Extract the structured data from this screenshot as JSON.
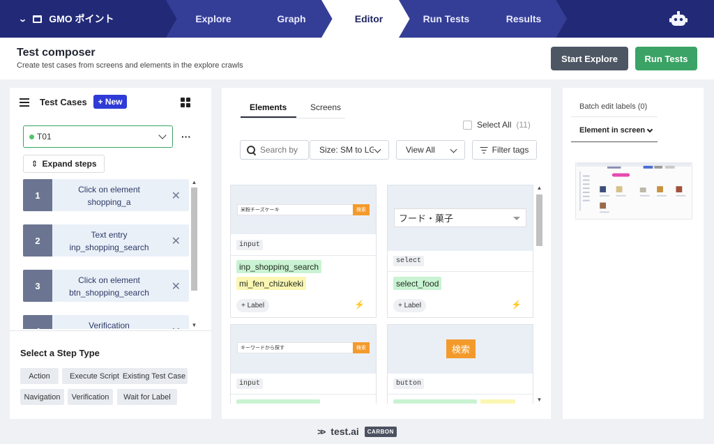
{
  "nav": {
    "brand": "GMO ポイント",
    "steps": [
      "Explore",
      "Graph",
      "Editor",
      "Run Tests",
      "Results"
    ],
    "active": "Editor"
  },
  "header": {
    "title": "Test composer",
    "subtitle": "Create test cases from screens and elements in the explore crawls",
    "start_explore": "Start Explore",
    "run_tests": "Run Tests"
  },
  "left": {
    "title": "Test Cases",
    "new_label": "+ New",
    "selected_case": "T01",
    "more": "···",
    "expand_steps": "Expand steps",
    "steps": [
      {
        "num": "1",
        "action": "Click on element",
        "target": "shopping_a"
      },
      {
        "num": "2",
        "action": "Text entry",
        "target": "inp_shopping_search"
      },
      {
        "num": "3",
        "action": "Click on element",
        "target": "btn_shopping_search"
      },
      {
        "num": "4",
        "action": "Verification",
        "target": ""
      }
    ],
    "step_type_title": "Select a Step Type",
    "step_types": [
      "Action",
      "Execute Script",
      "Existing Test Case",
      "Navigation",
      "Verification",
      "Wait for Label"
    ]
  },
  "center": {
    "tabs": [
      "Elements",
      "Screens"
    ],
    "select_all": "Select All",
    "select_all_count": "(11)",
    "search_placeholder": "Search by",
    "size_filter": "Size: SM to LG",
    "view_filter": "View All",
    "filter_tags": "Filter tags",
    "cards": [
      {
        "preview_input_text": "米粉チーズケーキ",
        "preview_btn_text": "検索",
        "type": "input",
        "labels": [
          "inp_shopping_search",
          "mi_fen_chizukeki"
        ],
        "add_label": "+ Label",
        "bolt": "⚡"
      },
      {
        "preview_select_text": "フード・菓子",
        "type": "select",
        "labels": [
          "select_food"
        ],
        "add_label": "+ Label",
        "bolt": "⚡"
      },
      {
        "preview_input_text": "キーワードから探す",
        "preview_btn_text": "検索",
        "type": "input"
      },
      {
        "preview_btn_text": "検索",
        "type": "button"
      }
    ]
  },
  "right": {
    "batch_edit": "Batch edit labels (0)",
    "element_in_screen": "Element in screen"
  },
  "footer": {
    "logo": "test.ai",
    "badge": "CARBON"
  },
  "colors": {
    "nav_bg": "#222a77",
    "nav_step": "#353e96",
    "accent_blue": "#2f3bd6",
    "accent_green": "#3aa365",
    "label_green": "#c9f3d2",
    "label_yellow": "#fbf6b3",
    "orange": "#f39a2c"
  }
}
